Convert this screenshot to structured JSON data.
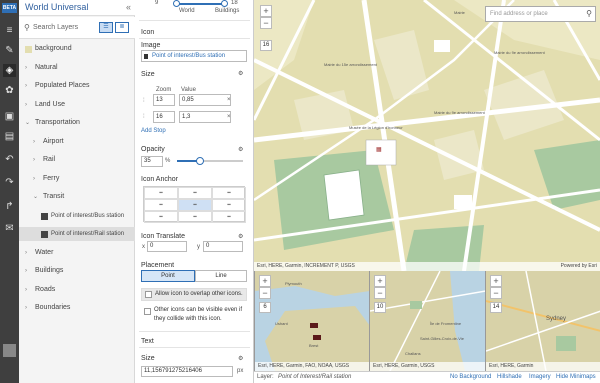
{
  "app": {
    "beta": "BETA",
    "title": "World Universal"
  },
  "search": {
    "placeholder": "Search Layers"
  },
  "layers": [
    {
      "label": "background",
      "indent": 0
    },
    {
      "label": "Natural",
      "indent": 0
    },
    {
      "label": "Populated Places",
      "indent": 0
    },
    {
      "label": "Land Use",
      "indent": 0
    },
    {
      "label": "Transportation",
      "indent": 0
    },
    {
      "label": "Airport",
      "indent": 1
    },
    {
      "label": "Rail",
      "indent": 1
    },
    {
      "label": "Ferry",
      "indent": 1
    },
    {
      "label": "Transit",
      "indent": 1
    },
    {
      "label": "Point of interest/Bus station",
      "indent": 2
    },
    {
      "label": "Point of interest/Rail station",
      "indent": 2
    },
    {
      "label": "Water",
      "indent": 0
    },
    {
      "label": "Buildings",
      "indent": 0
    },
    {
      "label": "Roads",
      "indent": 0
    },
    {
      "label": "Boundaries",
      "indent": 0
    }
  ],
  "zoom_range": {
    "min": "9",
    "max": "18",
    "label_left": "World",
    "label_right": "Buildings"
  },
  "icon": {
    "section": "Icon",
    "image_label": "Image",
    "image_value": "Point of interest/Bus station",
    "size_label": "Size",
    "zoom_header": "Zoom",
    "value_header": "Value",
    "stops": [
      {
        "zoom": "13",
        "value": "0,85"
      },
      {
        "zoom": "16",
        "value": "1,3"
      }
    ],
    "add_stop": "Add Stop",
    "opacity_label": "Opacity",
    "opacity_value": "35",
    "opacity_unit": "%",
    "opacity_fraction": 0.35,
    "anchor_label": "Icon Anchor",
    "translate_label": "Icon Translate",
    "translate_x_label": "x",
    "translate_x": "0",
    "translate_y_label": "y",
    "translate_y": "0",
    "placement_label": "Placement",
    "placement_point": "Point",
    "placement_line": "Line",
    "allow_overlap": "Allow icon to overlap other icons.",
    "other_icons": "Other icons can be visible even if they collide with this icon."
  },
  "text": {
    "section": "Text",
    "size_label": "Size",
    "size_value": "11,156791275216406",
    "size_unit": "px"
  },
  "map": {
    "search_placeholder": "Find address or place",
    "zoom_level": "16",
    "attribution": "Esri, HERE, Garmin, INCREMENT P, USGS",
    "powered_by": "Powered by Esri",
    "labels": [
      "Mairie du 15e arrondissement",
      "Mairie",
      "Mairie du 9e arrondissement",
      "Musée de la Légion d'honneur",
      "Mairie du 9e arrondissement"
    ]
  },
  "minimaps": [
    {
      "zoom": "6",
      "attribution": "Esri, HERE, Garmin, FAO, NOAA, USGS",
      "labels": [
        "Plymouth",
        "Ushant",
        "Brest"
      ]
    },
    {
      "zoom": "10",
      "attribution": "Esri, HERE, Garmin, USGS",
      "labels": [
        "Île de Fromentine",
        "Saint-Gilles-Croix-de-Vie",
        "Challans"
      ]
    },
    {
      "zoom": "14",
      "attribution": "Esri, HERE, Garmin",
      "labels": [
        "Sydney"
      ]
    }
  ],
  "status": {
    "layer_prefix": "Layer:",
    "layer_name": "Point of Interest/Rail station",
    "links": [
      "No Background",
      "Hillshade",
      "Imagery",
      "Hide Minimaps"
    ]
  },
  "colors": {
    "accent": "#2f6fb5",
    "map_land": "#e3deb0",
    "map_road": "#ffffff",
    "map_park": "#a8c9a0"
  }
}
